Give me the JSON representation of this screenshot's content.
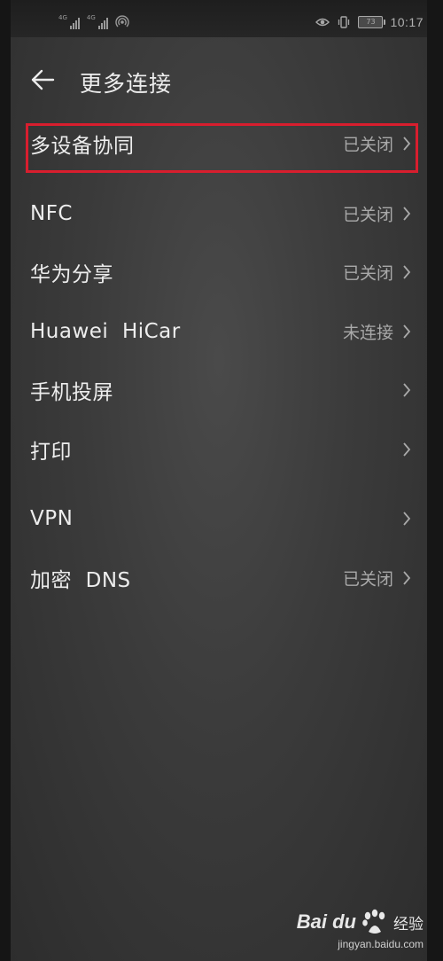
{
  "status_bar": {
    "signal_1_tag": "4G",
    "signal_2_tag": "4G",
    "battery_percent": "73",
    "time": "10:17"
  },
  "header": {
    "back_icon": "back-arrow-icon",
    "title": "更多连接"
  },
  "items": [
    {
      "label": "多设备协同",
      "value": "已关闭"
    },
    {
      "label": "NFC",
      "value": "已关闭"
    },
    {
      "label": "华为分享",
      "value": "已关闭"
    },
    {
      "label": "Huawei  HiCar",
      "value": "未连接"
    },
    {
      "label": "手机投屏",
      "value": ""
    },
    {
      "label": "打印",
      "value": ""
    },
    {
      "label": "VPN",
      "value": ""
    },
    {
      "label": "加密  DNS",
      "value": "已关闭"
    }
  ],
  "highlight_color": "#d81e2e",
  "watermark": {
    "brand": "Bai du",
    "cn": "经验",
    "url": "jingyan.baidu.com"
  }
}
